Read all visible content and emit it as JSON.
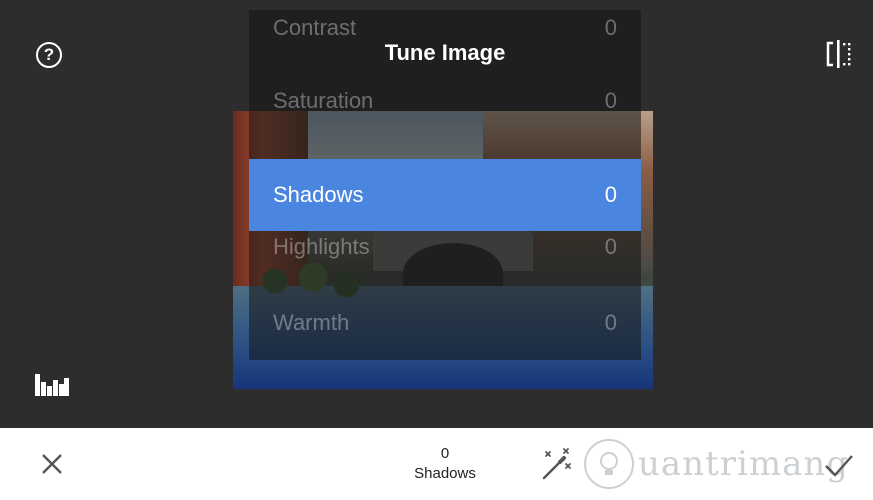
{
  "header": {
    "title": "Tune Image"
  },
  "menu": {
    "items": [
      {
        "label": "Contrast",
        "value": "0"
      },
      {
        "label": "Saturation",
        "value": "0"
      },
      {
        "label": "Shadows",
        "value": "0"
      },
      {
        "label": "Highlights",
        "value": "0"
      },
      {
        "label": "Warmth",
        "value": "0"
      }
    ],
    "selected": "Shadows"
  },
  "bottom_bar": {
    "readout_value": "0",
    "readout_label": "Shadows"
  },
  "icons": {
    "help": "help-icon",
    "compare": "compare-icon",
    "histogram": "histogram-icon",
    "close": "close-icon",
    "auto": "magic-wand-icon",
    "apply": "check-icon"
  },
  "colors": {
    "editor_bg": "#2d2d2d",
    "selected_bg": "#4a86e0",
    "bottom_bg": "#ffffff"
  },
  "watermark": {
    "text": "uantrimang"
  }
}
